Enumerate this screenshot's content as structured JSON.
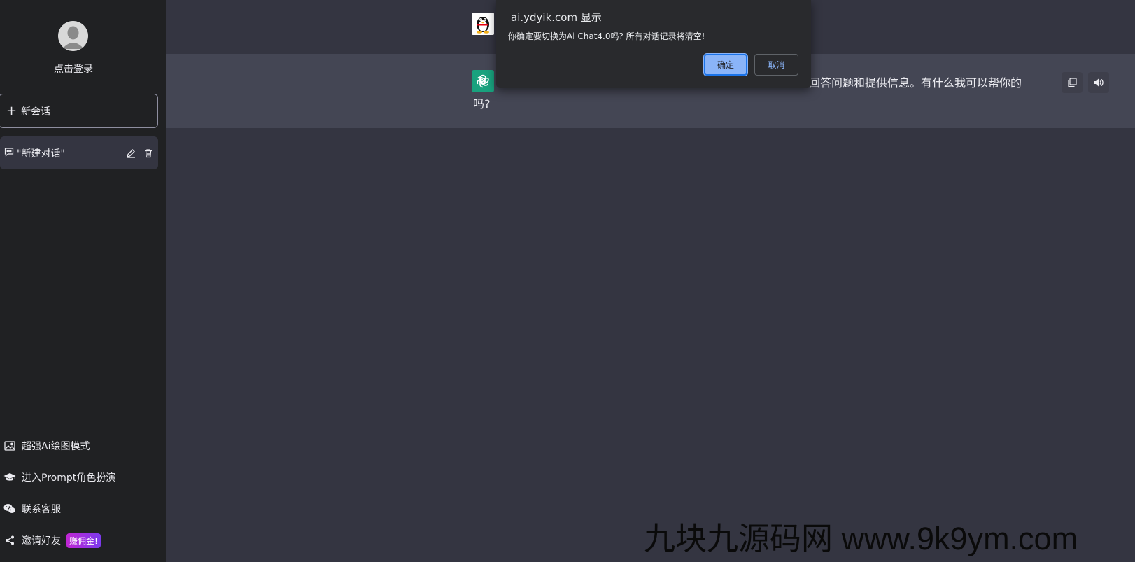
{
  "sidebar": {
    "login_text": "点击登录",
    "new_chat_label": "新会话",
    "conversations": [
      {
        "label": "\"新建对话\""
      }
    ],
    "menu": [
      {
        "label": "超强Ai绘图模式",
        "icon": "image-icon"
      },
      {
        "label": "进入Prompt角色扮演",
        "icon": "graduation-cap-icon"
      },
      {
        "label": "联系客服",
        "icon": "wechat-icon"
      },
      {
        "label": "邀请好友",
        "icon": "share-icon",
        "badge": "赚佣金!"
      }
    ]
  },
  "chat": {
    "bot_message_visible_1": "回答问题和提供信息。有什么我可以帮你的",
    "bot_message_visible_2": "吗?"
  },
  "dialog": {
    "title": "ai.ydyik.com 显示",
    "message": "你确定要切换为Ai Chat4.0吗? 所有对话记录将清空!",
    "ok_label": "确定",
    "cancel_label": "取消"
  },
  "watermark": "九块九源码网 www.9k9ym.com",
  "colors": {
    "sidebar_bg": "#202123",
    "main_bg": "#343541",
    "bot_row_bg": "#444654",
    "dialog_bg": "#292a2d",
    "accent": "#8ab4f8",
    "badge_gradient_start": "#c026d3",
    "badge_gradient_end": "#7c3aed",
    "bot_avatar": "#19a27e"
  }
}
